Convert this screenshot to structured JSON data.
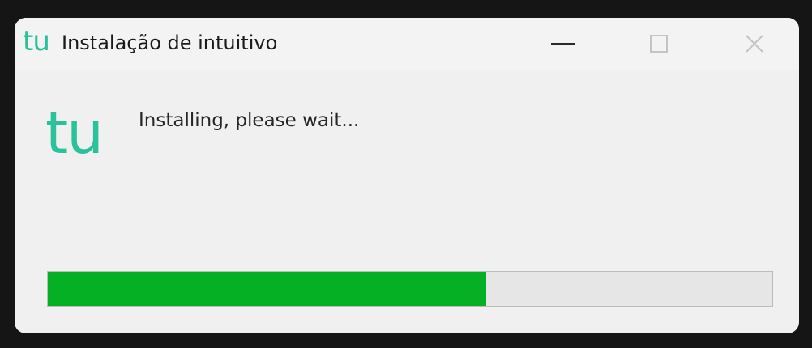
{
  "window": {
    "logo_text": "tu",
    "title": "Instalação de intuitivo"
  },
  "controls": {
    "minimize": "minimize-icon",
    "maximize": "maximize-icon",
    "close_glyph": "✕"
  },
  "content": {
    "logo_text": "tu",
    "status_message": "Installing, please wait..."
  },
  "progress": {
    "percent": 60.5
  },
  "colors": {
    "brand": "#2bc19a",
    "progress_fill": "#06b025",
    "progress_track": "#e6e6e6"
  }
}
